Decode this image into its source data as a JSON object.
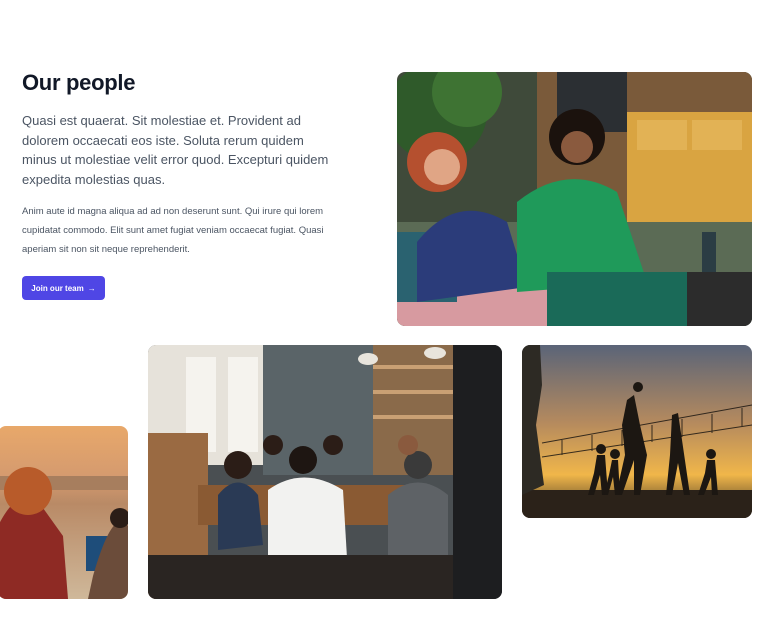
{
  "section": {
    "title": "Our people",
    "lead": "Quasi est quaerat. Sit molestiae et. Provident ad dolorem occaecati eos iste. Soluta rerum quidem minus ut molestiae velit error quod. Excepturi quidem expedita molestias quas.",
    "body": "Anim aute id magna aliqua ad ad non deserunt sunt. Qui irure qui lorem cupidatat commodo. Elit sunt amet fugiat veniam occaecat fugiat. Quasi aperiam sit non sit neque reprehenderit.",
    "cta_label": "Join our team",
    "cta_arrow": "→"
  },
  "colors": {
    "accent": "#4f46e5",
    "heading": "#111827",
    "text": "#4b5563"
  },
  "photos": [
    {
      "subject": "two-women-laughing-on-couch"
    },
    {
      "subject": "person-on-beach-at-sunset"
    },
    {
      "subject": "group-meeting-in-cafe"
    },
    {
      "subject": "beach-volleyball-silhouettes-sunset"
    }
  ]
}
